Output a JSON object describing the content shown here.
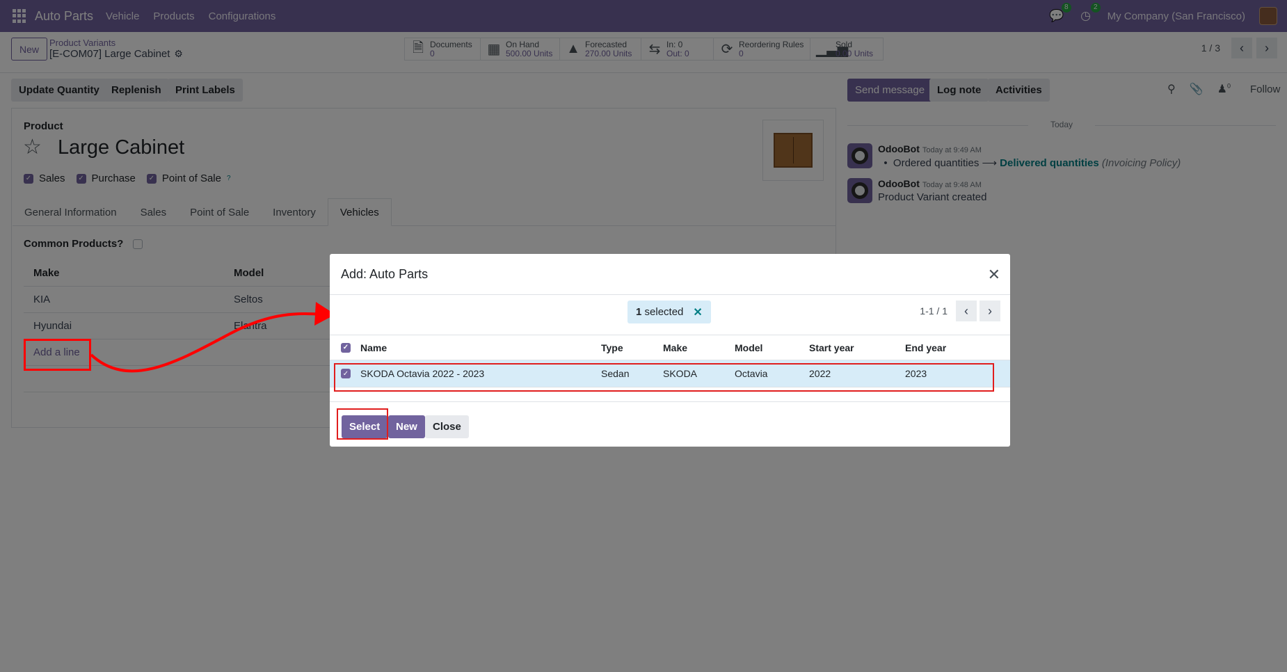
{
  "navbar": {
    "brand": "Auto Parts",
    "menu": [
      "Vehicle",
      "Products",
      "Configurations"
    ],
    "messages_count": "8",
    "activities_count": "2",
    "company": "My Company (San Francisco)"
  },
  "control": {
    "new_label": "New",
    "breadcrumb_parent": "Product Variants",
    "breadcrumb_current": "[E-COM07] Large Cabinet",
    "stats": [
      {
        "icon": "document-icon",
        "label": "Documents",
        "value": "0"
      },
      {
        "icon": "cubes-icon",
        "label": "On Hand",
        "value": "500.00 Units"
      },
      {
        "icon": "area-chart-icon",
        "label": "Forecasted",
        "value": "270.00 Units"
      },
      {
        "icon": "exchange-icon",
        "label": "In: 0",
        "value": "Out: 0"
      },
      {
        "icon": "refresh-icon",
        "label": "Reordering Rules",
        "value": "0"
      },
      {
        "icon": "signal-icon",
        "label": "Sold",
        "value": "0.00 Units"
      }
    ],
    "pager": "1 / 3"
  },
  "actions": {
    "update_quantity": "Update Quantity",
    "replenish": "Replenish",
    "print_labels": "Print Labels"
  },
  "form": {
    "product_label": "Product",
    "name": "Large Cabinet",
    "checks": [
      {
        "label": "Sales",
        "checked": true
      },
      {
        "label": "Purchase",
        "checked": true
      },
      {
        "label": "Point of Sale",
        "checked": true,
        "help": "?"
      }
    ],
    "tabs": [
      "General Information",
      "Sales",
      "Point of Sale",
      "Inventory",
      "Vehicles"
    ],
    "active_tab": "Vehicles",
    "common_products_label": "Common Products?",
    "vehicles_table": {
      "headers": [
        "Make",
        "Model"
      ],
      "rows": [
        {
          "make": "KIA",
          "model": "Seltos"
        },
        {
          "make": "Hyundai",
          "model": "Elantra"
        }
      ],
      "add_line": "Add a line"
    }
  },
  "chatter": {
    "send_message": "Send message",
    "log_note": "Log note",
    "activities": "Activities",
    "followers_count": "0",
    "follow": "Follow",
    "today": "Today",
    "messages": [
      {
        "author": "OdooBot",
        "time": "Today at 9:49 AM",
        "from": "Ordered quantities",
        "to": "Delivered quantities",
        "field": "(Invoicing Policy)"
      },
      {
        "author": "OdooBot",
        "time": "Today at 9:48 AM",
        "body": "Product Variant created"
      }
    ]
  },
  "dialog": {
    "title": "Add: Auto Parts",
    "selected_count": "1",
    "selected_text": "selected",
    "pager": "1-1 / 1",
    "headers": [
      "Name",
      "Type",
      "Make",
      "Model",
      "Start year",
      "End year"
    ],
    "rows": [
      {
        "name": "SKODA Octavia 2022 - 2023",
        "type": "Sedan",
        "make": "SKODA",
        "model": "Octavia",
        "start_year": "2022",
        "end_year": "2023"
      }
    ],
    "select_label": "Select",
    "new_label": "New",
    "close_label": "Close"
  },
  "colors": {
    "brand": "#71639e",
    "selected_row": "#d7ecf8",
    "annotation": "#ff0000"
  }
}
